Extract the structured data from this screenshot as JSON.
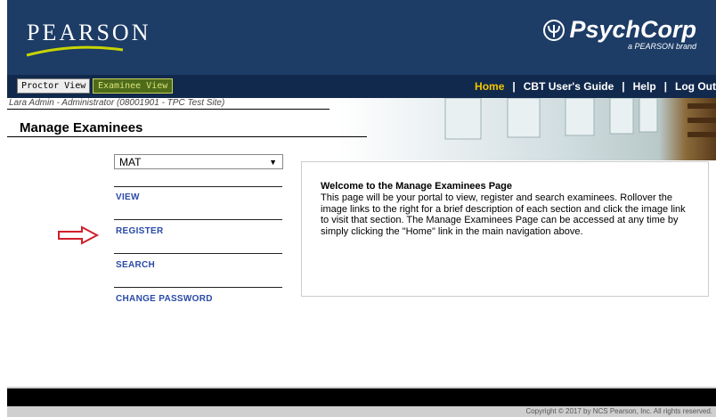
{
  "brand": {
    "pearson": "PEARSON",
    "psychcorp": "PsychCorp",
    "psychcorp_sub": "a PEARSON brand",
    "header_bg": "#1d3c66"
  },
  "nav": {
    "proctor_view": "Proctor View",
    "examinee_view": "Examinee View",
    "home": "Home",
    "separator": "|",
    "guide": "CBT User's Guide",
    "help": "Help",
    "logout": "Log Out"
  },
  "user_line": "Lara  Admin - Administrator  (08001901 - TPC Test Site)",
  "page_title": "Manage Examinees",
  "test_select": {
    "value": "MAT"
  },
  "menu": {
    "view": "VIEW",
    "register": "REGISTER",
    "search": "SEARCH",
    "change_password": "CHANGE PASSWORD"
  },
  "welcome": {
    "title": "Welcome to the Manage Examinees Page",
    "body": "This page will be your portal to view, register and search examinees. Rollover the image links to the right for a brief description of each section and click the image link to visit that section. The Manage Examinees Page can be accessed at any time by simply clicking the \"Home\" link in the main navigation above."
  },
  "footer": {
    "copyright": "Copyright © 2017 by NCS Pearson, Inc. All rights reserved."
  },
  "icons": [
    "pearson-swoosh-icon",
    "psi-logo-icon",
    "right-arrow-icon",
    "chevron-down-icon"
  ]
}
